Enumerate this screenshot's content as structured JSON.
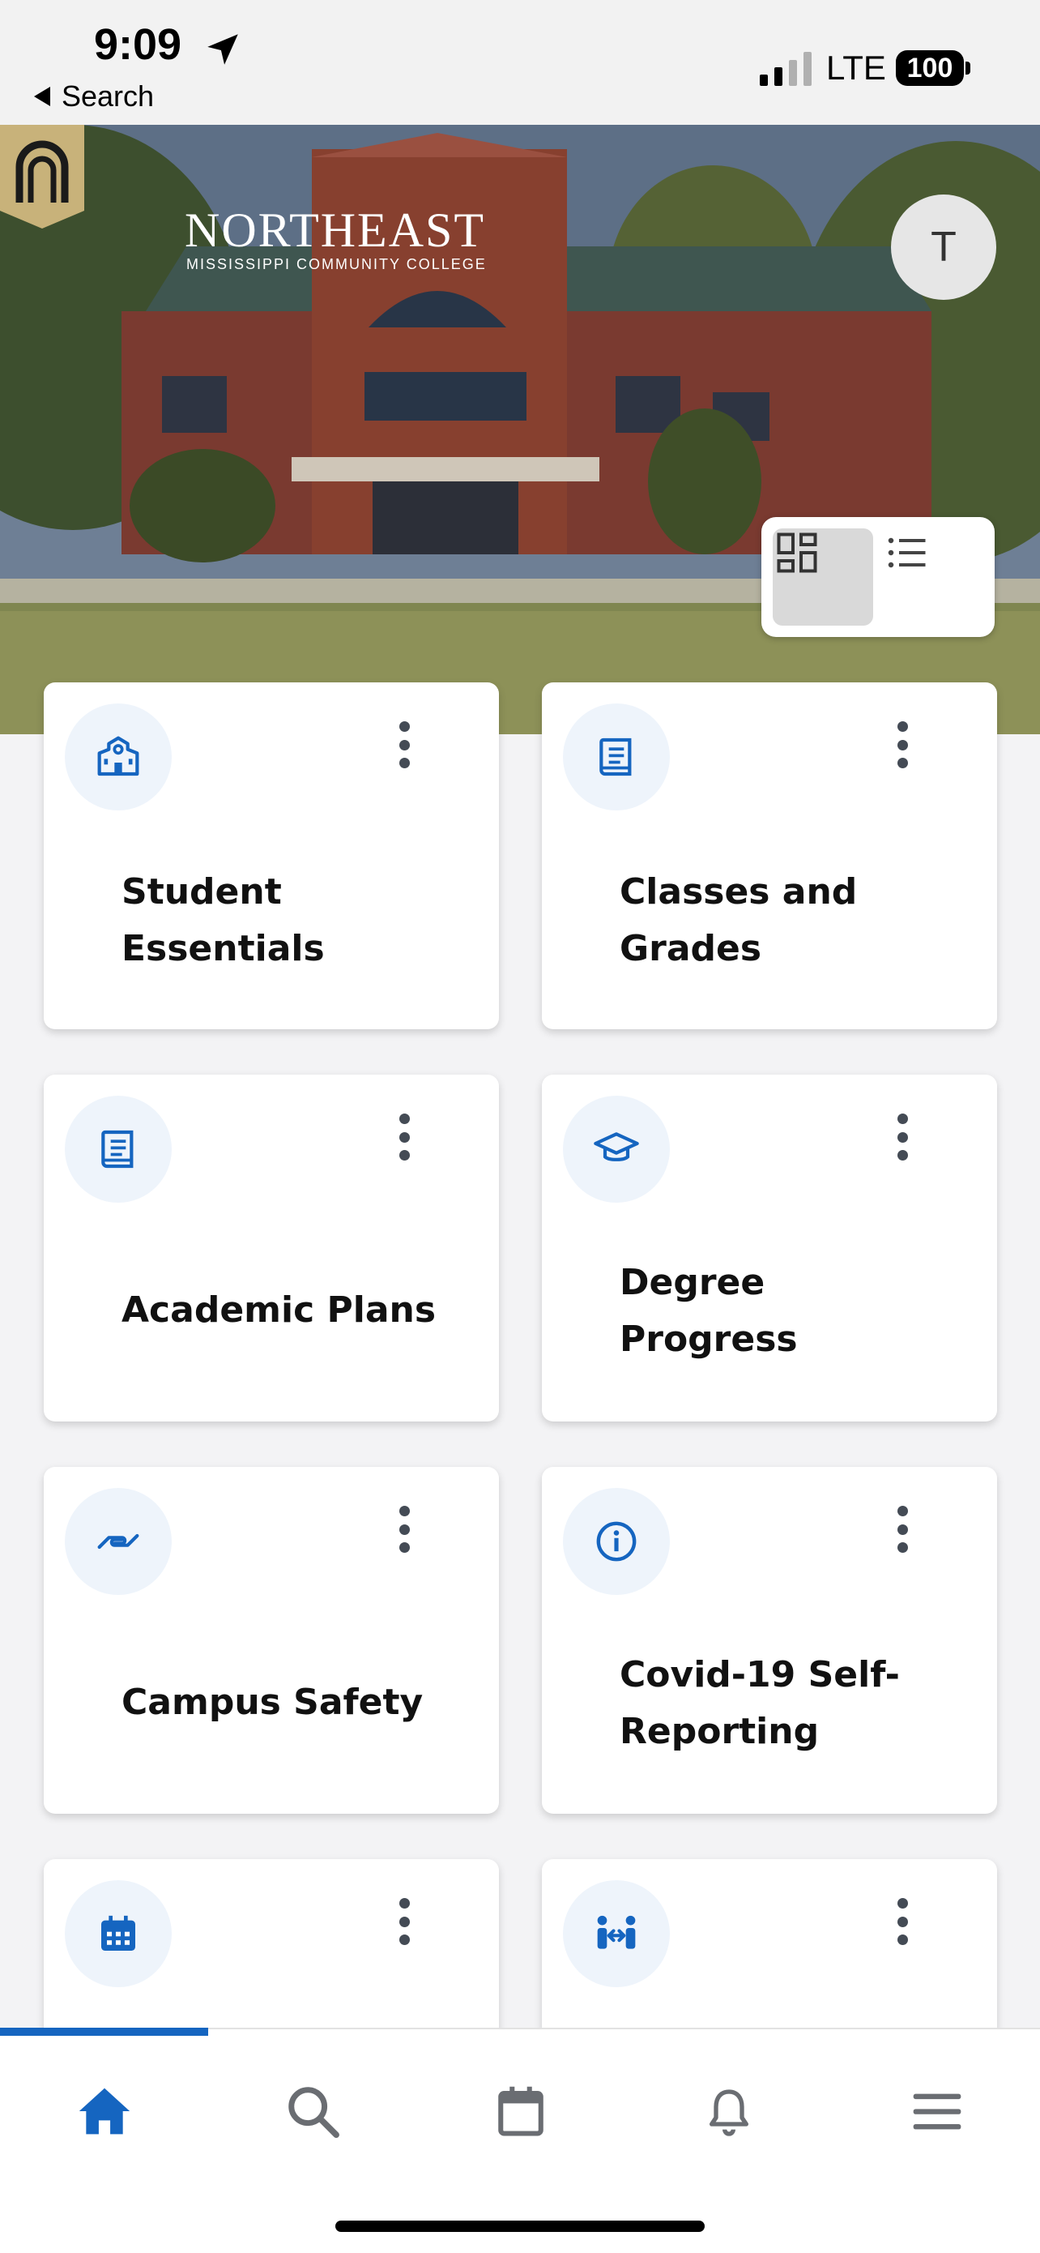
{
  "status_bar": {
    "time": "9:09",
    "back_label": "Search",
    "network": "LTE",
    "battery": "100"
  },
  "header": {
    "college_name": "NORTHEAST",
    "college_subtitle": "MISSISSIPPI COMMUNITY COLLEGE",
    "avatar_initial": "T"
  },
  "cards": [
    {
      "title_line1": "Student",
      "title_line2": "Essentials",
      "icon": "school-building-icon"
    },
    {
      "title_line1": "Classes and",
      "title_line2": "Grades",
      "icon": "book-icon"
    },
    {
      "title_line1": "Academic Plans",
      "title_line2": "",
      "icon": "book-icon"
    },
    {
      "title_line1": "Degree",
      "title_line2": "Progress",
      "icon": "graduation-cap-icon"
    },
    {
      "title_line1": "Campus Safety",
      "title_line2": "",
      "icon": "helping-hand-icon"
    },
    {
      "title_line1": "Covid-19 Self-",
      "title_line2": "Reporting",
      "icon": "info-icon"
    },
    {
      "title_line1": "",
      "title_line2": "",
      "icon": "calendar-icon"
    },
    {
      "title_line1": "",
      "title_line2": "",
      "icon": "people-exchange-icon"
    }
  ],
  "bottom_nav": [
    "home-icon",
    "search-icon",
    "calendar-icon",
    "bell-icon",
    "menu-icon"
  ],
  "colors": {
    "accent": "#1565c0",
    "icon_bg": "#eef4fb",
    "dots": "#444b55"
  }
}
